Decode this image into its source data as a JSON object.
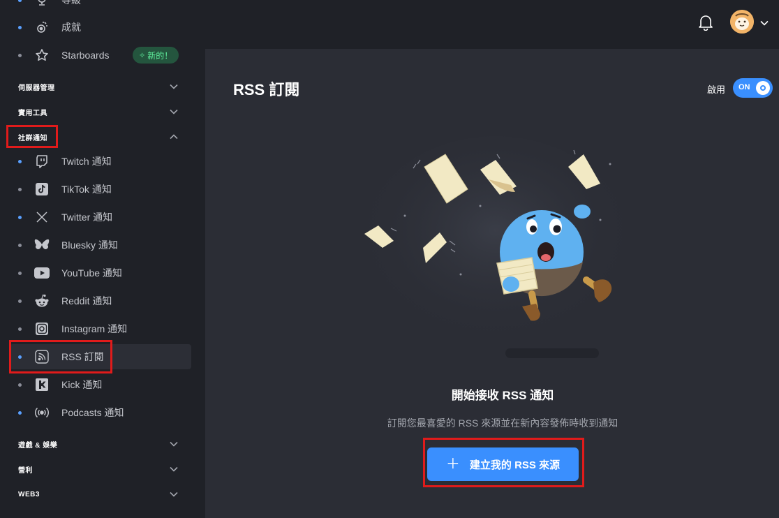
{
  "sidebar": {
    "top_items": [
      {
        "label": "等級",
        "icon": "trophy-icon"
      },
      {
        "label": "成就",
        "icon": "medal-icon"
      },
      {
        "label": "Starboards",
        "icon": "star-icon",
        "badge": "新的！"
      }
    ],
    "sections": [
      {
        "label": "伺服器管理",
        "state": "collapsed"
      },
      {
        "label": "實用工具",
        "state": "collapsed"
      },
      {
        "label": "社群通知",
        "state": "expanded"
      }
    ],
    "social_items": [
      {
        "label": "Twitch 通知",
        "icon": "twitch-icon"
      },
      {
        "label": "TikTok 通知",
        "icon": "tiktok-icon"
      },
      {
        "label": "Twitter 通知",
        "icon": "x-icon"
      },
      {
        "label": "Bluesky 通知",
        "icon": "butterfly-icon"
      },
      {
        "label": "YouTube 通知",
        "icon": "youtube-icon"
      },
      {
        "label": "Reddit 通知",
        "icon": "reddit-icon"
      },
      {
        "label": "Instagram 通知",
        "icon": "instagram-icon"
      },
      {
        "label": "RSS 訂閱",
        "icon": "rss-icon",
        "active": true
      },
      {
        "label": "Kick 通知",
        "icon": "kick-icon"
      },
      {
        "label": "Podcasts 通知",
        "icon": "podcast-icon"
      }
    ],
    "bottom_sections": [
      {
        "label": "遊戲 & 娛樂"
      },
      {
        "label": "營利"
      },
      {
        "label": "WEB3"
      }
    ]
  },
  "main": {
    "title": "RSS 訂閱",
    "toggle_label": "啟用",
    "toggle_state": "ON",
    "empty_title": "開始接收 RSS 通知",
    "empty_description": "訂閱您最喜愛的 RSS 來源並在新內容發佈時收到通知",
    "create_button": "建立我的 RSS 來源"
  },
  "colors": {
    "accent": "#3a8ffe",
    "sidebar_bg": "#1f2127",
    "main_bg": "#2b2d35",
    "badge_bg": "#24553e",
    "badge_text": "#5ff09d",
    "highlight_box": "#e01b1b"
  }
}
